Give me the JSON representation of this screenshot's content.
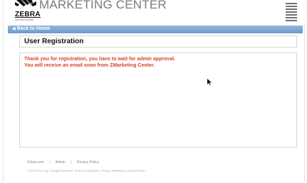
{
  "header": {
    "logo_text": "ZEBRA",
    "logo_subtext": "TECHNOLOGIES",
    "title": "MARKETING CENTER",
    "menu_icon": "hamburger-menu-icon"
  },
  "nav": {
    "back_label": "Back to Home",
    "back_icon": "chevron-left-icon"
  },
  "page": {
    "title": "User Registration",
    "messages": [
      "Thank you for registration, you have to wait for admin approval.",
      "You will receive an email soon from ZMarketing Center."
    ]
  },
  "footer": {
    "links": [
      "Zebra.com",
      "Admin",
      "Privacy Policy"
    ],
    "separator": "|",
    "copyright": "© 2016 ZIH Corp. All rights reserved. Terms & Conditions | Privacy Statement | Contact Zebra"
  },
  "colors": {
    "accent": "#6c9bcc",
    "message": "#d9432b",
    "title_gray": "#7a7a7a"
  }
}
